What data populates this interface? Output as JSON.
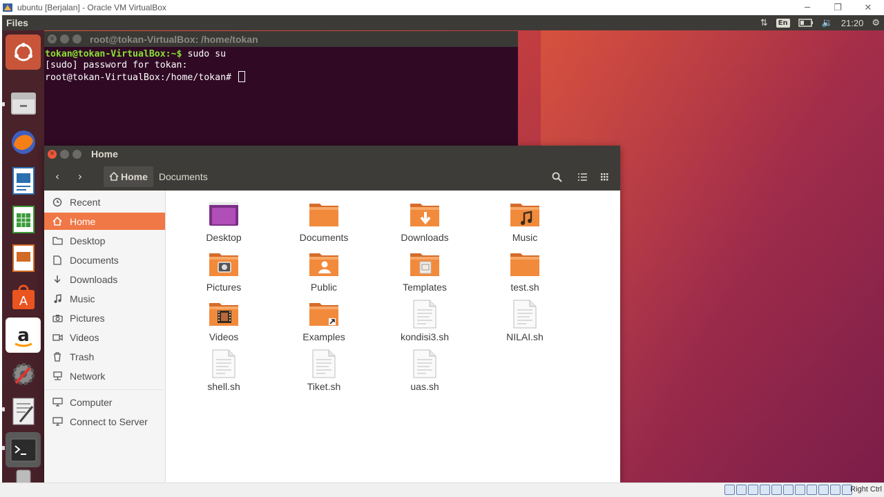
{
  "host_window": {
    "title": "ubuntu  [Berjalan] - Oracle VM VirtualBox",
    "minimize": "─",
    "restore": "❐",
    "close": "✕"
  },
  "top_panel": {
    "app_name": "Files",
    "lang": "En",
    "clock": "21:20"
  },
  "terminal": {
    "title": "root@tokan-VirtualBox: /home/tokan",
    "line1_prompt": "tokan@tokan-VirtualBox:~$",
    "line1_cmd": " sudo su",
    "line2": "[sudo] password for tokan:",
    "line3_prompt": "root@tokan-VirtualBox:/home/tokan#"
  },
  "files_window": {
    "title": "Home",
    "breadcrumbs": [
      "Home",
      "Documents"
    ],
    "sidebar": [
      {
        "label": "Recent",
        "icon": "clock-icon"
      },
      {
        "label": "Home",
        "icon": "home-icon"
      },
      {
        "label": "Desktop",
        "icon": "folder-icon"
      },
      {
        "label": "Documents",
        "icon": "document-icon"
      },
      {
        "label": "Downloads",
        "icon": "download-icon"
      },
      {
        "label": "Music",
        "icon": "music-icon"
      },
      {
        "label": "Pictures",
        "icon": "camera-icon"
      },
      {
        "label": "Videos",
        "icon": "video-icon"
      },
      {
        "label": "Trash",
        "icon": "trash-icon"
      },
      {
        "label": "Network",
        "icon": "network-icon"
      },
      {
        "label": "Computer",
        "icon": "computer-icon"
      },
      {
        "label": "Connect to Server",
        "icon": "server-icon"
      }
    ],
    "items": [
      {
        "label": "Desktop",
        "kind": "desktop"
      },
      {
        "label": "Documents",
        "kind": "folder"
      },
      {
        "label": "Downloads",
        "kind": "folder-download"
      },
      {
        "label": "Music",
        "kind": "folder-music"
      },
      {
        "label": "Pictures",
        "kind": "folder-pictures"
      },
      {
        "label": "Public",
        "kind": "folder-public"
      },
      {
        "label": "Templates",
        "kind": "folder-templates"
      },
      {
        "label": "test.sh",
        "kind": "folder"
      },
      {
        "label": "Videos",
        "kind": "folder-videos"
      },
      {
        "label": "Examples",
        "kind": "folder-link"
      },
      {
        "label": "kondisi3.sh",
        "kind": "file"
      },
      {
        "label": "NILAI.sh",
        "kind": "file"
      },
      {
        "label": "shell.sh",
        "kind": "file"
      },
      {
        "label": "Tiket.sh",
        "kind": "file"
      },
      {
        "label": "uas.sh",
        "kind": "file"
      }
    ]
  },
  "status_bar": {
    "host_key": "Right Ctrl"
  },
  "colors": {
    "accent": "#f07746",
    "terminal_bg": "#300a24",
    "panel_bg": "#3c3b37"
  }
}
